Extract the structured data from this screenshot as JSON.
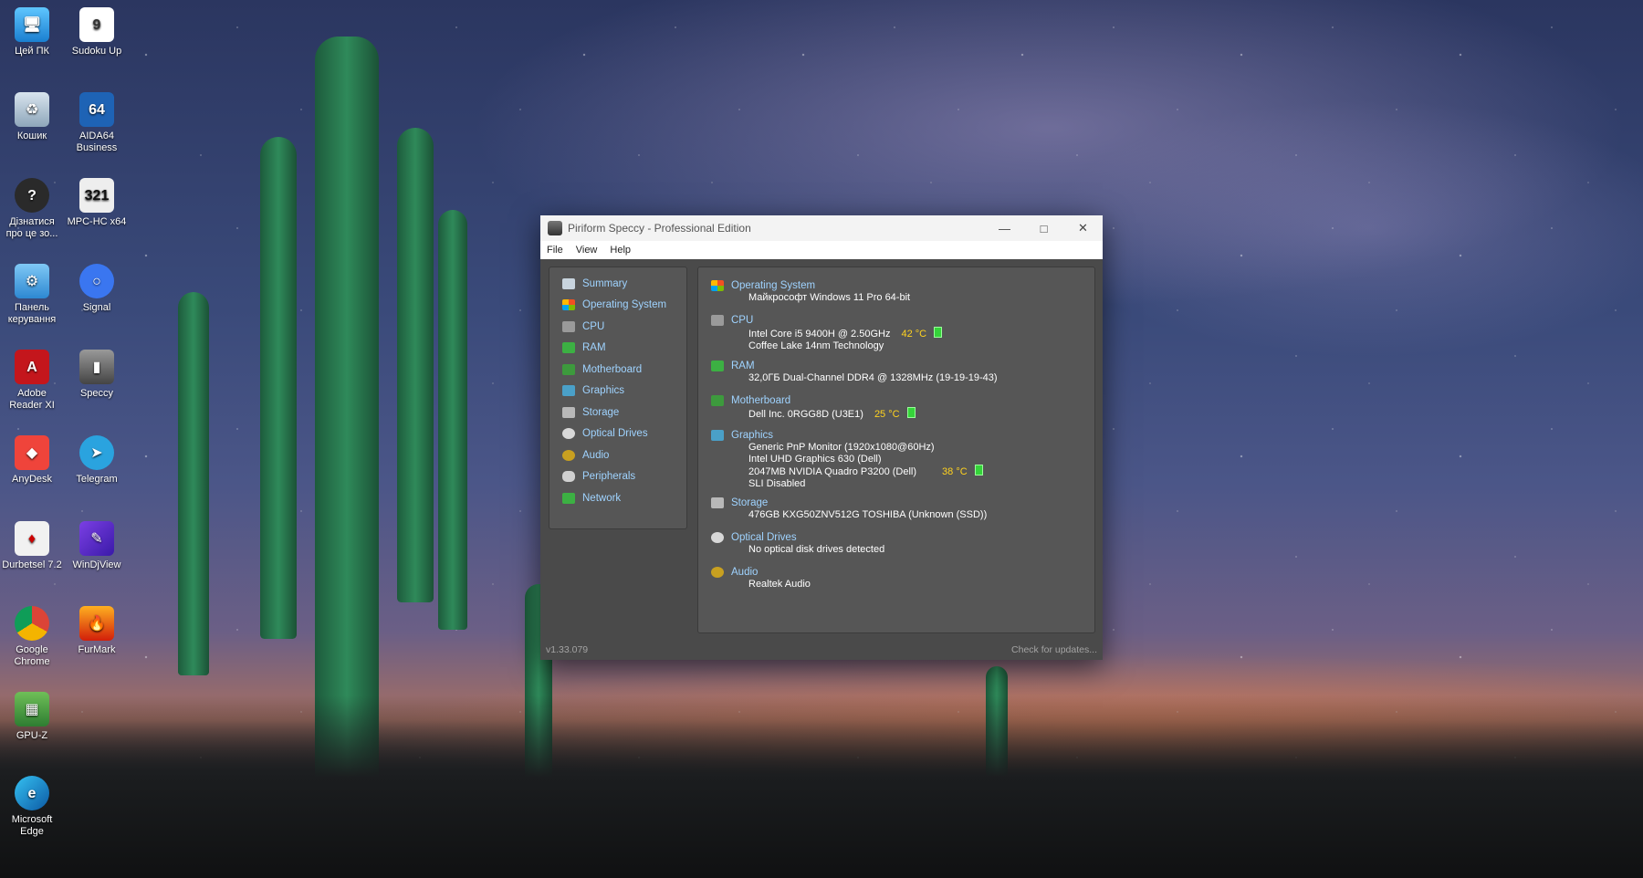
{
  "desktop": {
    "icons": [
      {
        "label": "Цей ПК"
      },
      {
        "label": "Sudoku Up"
      },
      {
        "label": "Кошик"
      },
      {
        "label": "AIDA64 Business"
      },
      {
        "label": "Дізнатися про це зо..."
      },
      {
        "label": "MPC-HC x64"
      },
      {
        "label": "Панель керування"
      },
      {
        "label": "Signal"
      },
      {
        "label": "Adobe Reader XI"
      },
      {
        "label": "Speccy"
      },
      {
        "label": "AnyDesk"
      },
      {
        "label": "Telegram"
      },
      {
        "label": "Durbetsel 7.2"
      },
      {
        "label": "WinDjView"
      },
      {
        "label": "Google Chrome"
      },
      {
        "label": "FurMark"
      },
      {
        "label": "GPU-Z"
      },
      {
        "label": "Microsoft Edge"
      }
    ]
  },
  "window": {
    "title": "Piriform Speccy - Professional Edition",
    "menu": [
      "File",
      "View",
      "Help"
    ],
    "nav": [
      {
        "label": "Summary",
        "color": "#c8d4de"
      },
      {
        "label": "Operating System",
        "color": "#e0a030"
      },
      {
        "label": "CPU",
        "color": "#9a9a9a"
      },
      {
        "label": "RAM",
        "color": "#3cb043"
      },
      {
        "label": "Motherboard",
        "color": "#3d9a3d"
      },
      {
        "label": "Graphics",
        "color": "#4aa0c8"
      },
      {
        "label": "Storage",
        "color": "#b8b8b8"
      },
      {
        "label": "Optical Drives",
        "color": "#d8d8d8"
      },
      {
        "label": "Audio",
        "color": "#c8a020"
      },
      {
        "label": "Peripherals",
        "color": "#d0d0d0"
      },
      {
        "label": "Network",
        "color": "#3cb043"
      }
    ],
    "sections": {
      "os": {
        "title": "Operating System",
        "lines": [
          "Майкрософт Windows 11 Pro 64-bit"
        ]
      },
      "cpu": {
        "title": "CPU",
        "line1": "Intel Core i5 9400H @ 2.50GHz",
        "temp": "42 °C",
        "line2": "Coffee Lake 14nm Technology"
      },
      "ram": {
        "title": "RAM",
        "line1": "32,0ГБ Dual-Channel DDR4 @ 1328MHz (19-19-19-43)"
      },
      "motherboard": {
        "title": "Motherboard",
        "line1": "Dell Inc. 0RGG8D (U3E1)",
        "temp": "25 °C"
      },
      "graphics": {
        "title": "Graphics",
        "line1": "Generic PnP Monitor (1920x1080@60Hz)",
        "line2": "Intel UHD Graphics 630 (Dell)",
        "line3": "2047MB NVIDIA Quadro P3200 (Dell)",
        "temp": "38 °C",
        "line4": "SLI Disabled"
      },
      "storage": {
        "title": "Storage",
        "line1": "476GB KXG50ZNV512G TOSHIBA (Unknown (SSD))"
      },
      "optical": {
        "title": "Optical Drives",
        "line1": "No optical disk drives detected"
      },
      "audio": {
        "title": "Audio",
        "line1": "Realtek Audio"
      }
    },
    "status": {
      "version": "v1.33.079",
      "update": "Check for updates..."
    }
  }
}
